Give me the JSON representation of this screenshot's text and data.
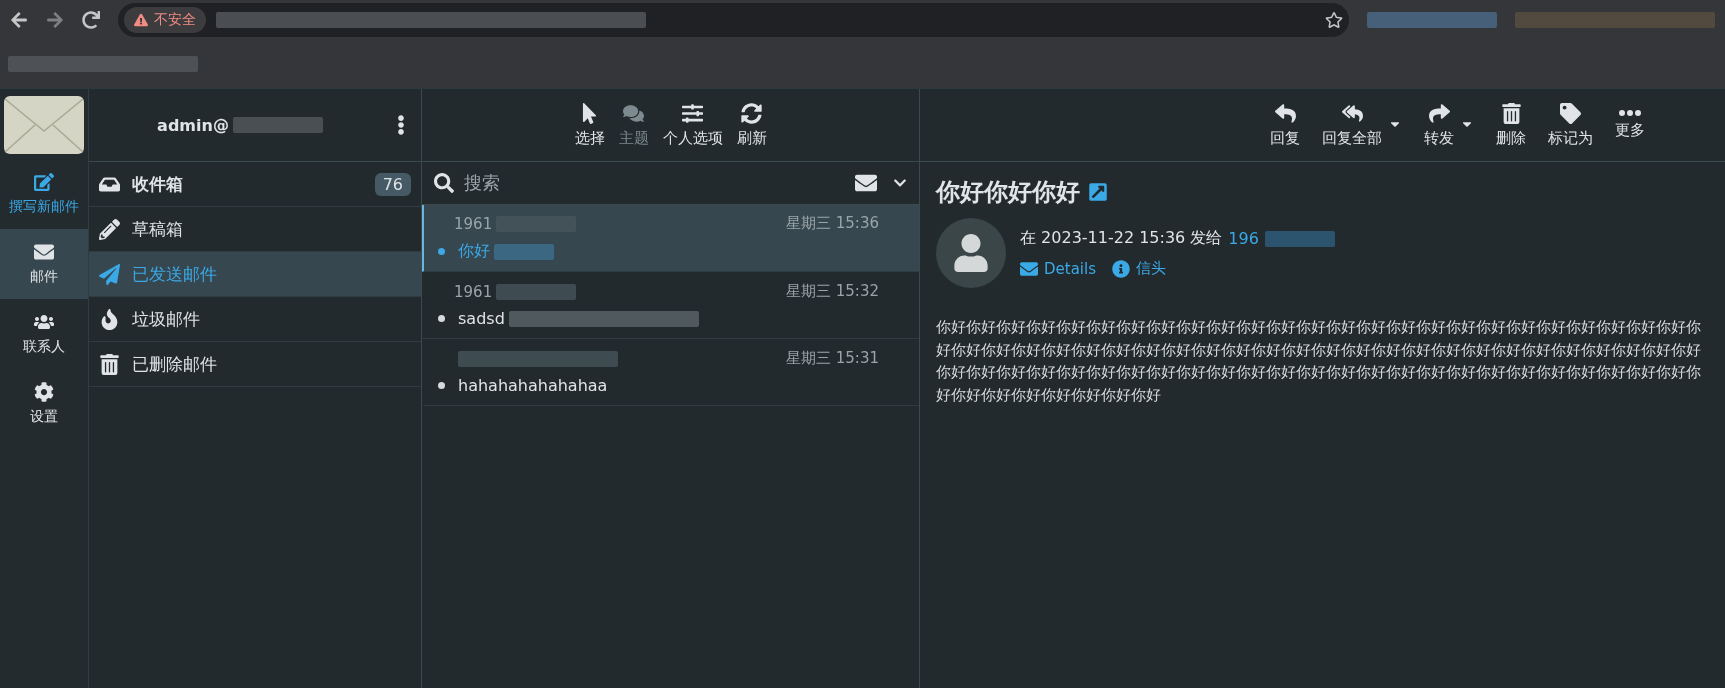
{
  "browser": {
    "security_label": "不安全"
  },
  "nav": [
    {
      "kind": "compose",
      "label": "撰写新邮件",
      "selected": false
    },
    {
      "kind": "mail",
      "label": "邮件",
      "selected": true
    },
    {
      "kind": "contacts",
      "label": "联系人",
      "selected": false
    },
    {
      "kind": "settings",
      "label": "设置",
      "selected": false
    }
  ],
  "account": "admin@",
  "folders": [
    {
      "kind": "inbox",
      "label": "收件箱",
      "count": "76",
      "selected": false
    },
    {
      "kind": "drafts",
      "label": "草稿箱",
      "selected": false
    },
    {
      "kind": "sent",
      "label": "已发送邮件",
      "selected": true
    },
    {
      "kind": "junk",
      "label": "垃圾邮件",
      "selected": false
    },
    {
      "kind": "trash",
      "label": "已删除邮件",
      "selected": false
    }
  ],
  "list_toolbar": [
    {
      "kind": "select",
      "label": "选择",
      "disabled": false
    },
    {
      "kind": "threads",
      "label": "主题",
      "disabled": true
    },
    {
      "kind": "options",
      "label": "个人选项",
      "disabled": false
    },
    {
      "kind": "refresh",
      "label": "刷新",
      "disabled": false
    }
  ],
  "search": {
    "placeholder": "搜索"
  },
  "messages": [
    {
      "from": "1961",
      "time": "星期三 15:36",
      "subject": "你好",
      "selected": true
    },
    {
      "from": "1961",
      "time": "星期三 15:32",
      "subject": "sadsd",
      "selected": false
    },
    {
      "time": "星期三 15:31",
      "subject": "hahahahahahahaa",
      "selected": false
    }
  ],
  "message_toolbar": [
    {
      "kind": "reply",
      "label": "回复",
      "menu": false
    },
    {
      "kind": "reply_all",
      "label": "回复全部",
      "menu": true
    },
    {
      "kind": "forward",
      "label": "转发",
      "menu": true
    },
    {
      "kind": "delete",
      "label": "删除",
      "menu": false
    },
    {
      "kind": "mark",
      "label": "标记为",
      "menu": false
    },
    {
      "kind": "more",
      "label": "更多",
      "menu": false
    }
  ],
  "message": {
    "subject": "你好你好你好",
    "meta": "在 2023-11-22 15:36 发给",
    "recipient": "196",
    "links": [
      {
        "kind": "details",
        "label": "Details"
      },
      {
        "kind": "headers",
        "label": "信头"
      }
    ],
    "body": "你好你好你好你好你好你好你好你好你好你好你好你好你好你好你好你好你好你好你好你好你好你好你好你好你好你好你好你好你好你好你好你好你好你好你好你好你好你好你好你好你好你好你好你好你好你好你好你好你好你好你好你好你好你好你好你好你好你好你好你好你好你好你好你好你好你好你好你好你好你好你好你好你好你好你好你好你好你好你好你好你好你好你好你好"
  }
}
